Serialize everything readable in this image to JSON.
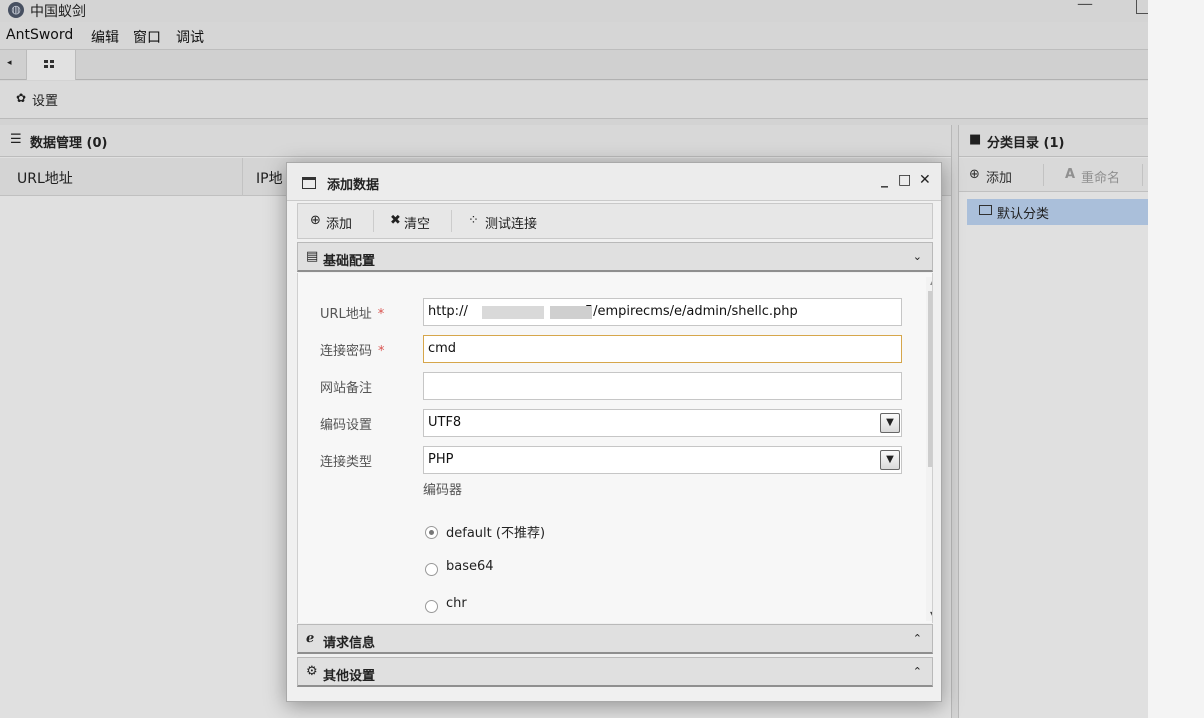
{
  "window": {
    "title": "中国蚁剑",
    "app_icon": "ant-logo-icon",
    "minimize_glyph": "—"
  },
  "menu": [
    "AntSword",
    "编辑",
    "窗口",
    "调试"
  ],
  "tabs": {
    "left_arrow_glyph": "◂",
    "home_icon": "grid-icon"
  },
  "settings": {
    "icon": "gear-icon",
    "icon_glyph": "✿",
    "label": "设置"
  },
  "data_panel": {
    "icon": "list-icon",
    "icon_glyph": "☰",
    "title": "数据管理 (0)",
    "columns": [
      "URL地址",
      "IP地"
    ]
  },
  "category_panel": {
    "icon": "folder-icon",
    "icon_glyph": "■",
    "title": "分类目录 (1)",
    "add_label": "添加",
    "add_glyph": "⊕",
    "rename_label": "重命名",
    "rename_glyph": "A",
    "items": [
      "默认分类"
    ]
  },
  "dialog": {
    "title": "添加数据",
    "controls": [
      "_",
      "□",
      "✕"
    ],
    "toolbar": {
      "add_label": "添加",
      "add_glyph": "⊕",
      "clear_label": "清空",
      "clear_glyph": "✖",
      "test_label": "测试连接",
      "test_glyph": "⁘"
    },
    "basic_section": {
      "icon_glyph": "▤",
      "label": "基础配置",
      "chevron": "⌄"
    },
    "fields": {
      "url": {
        "label": "URL地址",
        "required": "*",
        "value_prefix": "http://",
        "value_suffix": "5/empirecms/e/admin/shellc.php"
      },
      "password": {
        "label": "连接密码",
        "required": "*",
        "value": "cmd"
      },
      "note": {
        "label": "网站备注",
        "value": ""
      },
      "encoding": {
        "label": "编码设置",
        "value": "UTF8",
        "caret": "▼"
      },
      "type": {
        "label": "连接类型",
        "value": "PHP",
        "caret": "▼"
      }
    },
    "encoder": {
      "label": "编码器",
      "options": [
        "default (不推荐)",
        "base64",
        "chr"
      ],
      "selected": 0
    },
    "request_section": {
      "icon_glyph": "ℯ",
      "label": "请求信息",
      "chevron": "⌃"
    },
    "other_section": {
      "icon_glyph": "⚙",
      "label": "其他设置",
      "chevron": "⌃"
    }
  }
}
